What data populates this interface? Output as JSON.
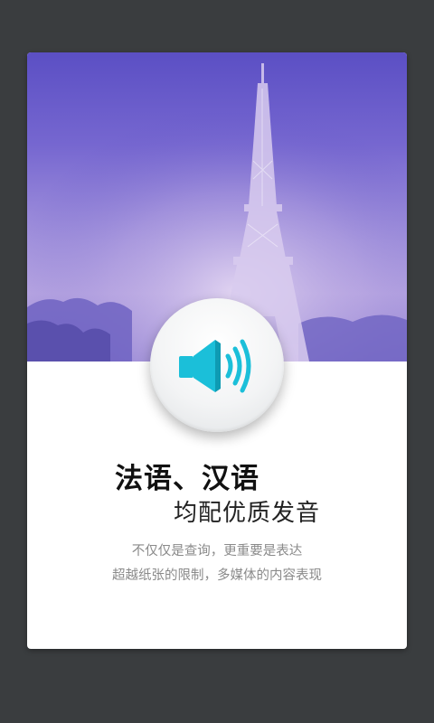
{
  "feature_card": {
    "headline": "法语、汉语",
    "subheadline": "均配优质发音",
    "description_line1": "不仅仅是查询，更重要是表达",
    "description_line2": "超越纸张的限制，多媒体的内容表现"
  },
  "icons": {
    "speaker": "speaker-volume-icon",
    "hero_image": "eiffel-tower-photo"
  },
  "colors": {
    "background": "#3a3d3f",
    "card": "#ffffff",
    "hero_purple": "#5b4fc4",
    "speaker_accent": "#1bbfd9"
  }
}
